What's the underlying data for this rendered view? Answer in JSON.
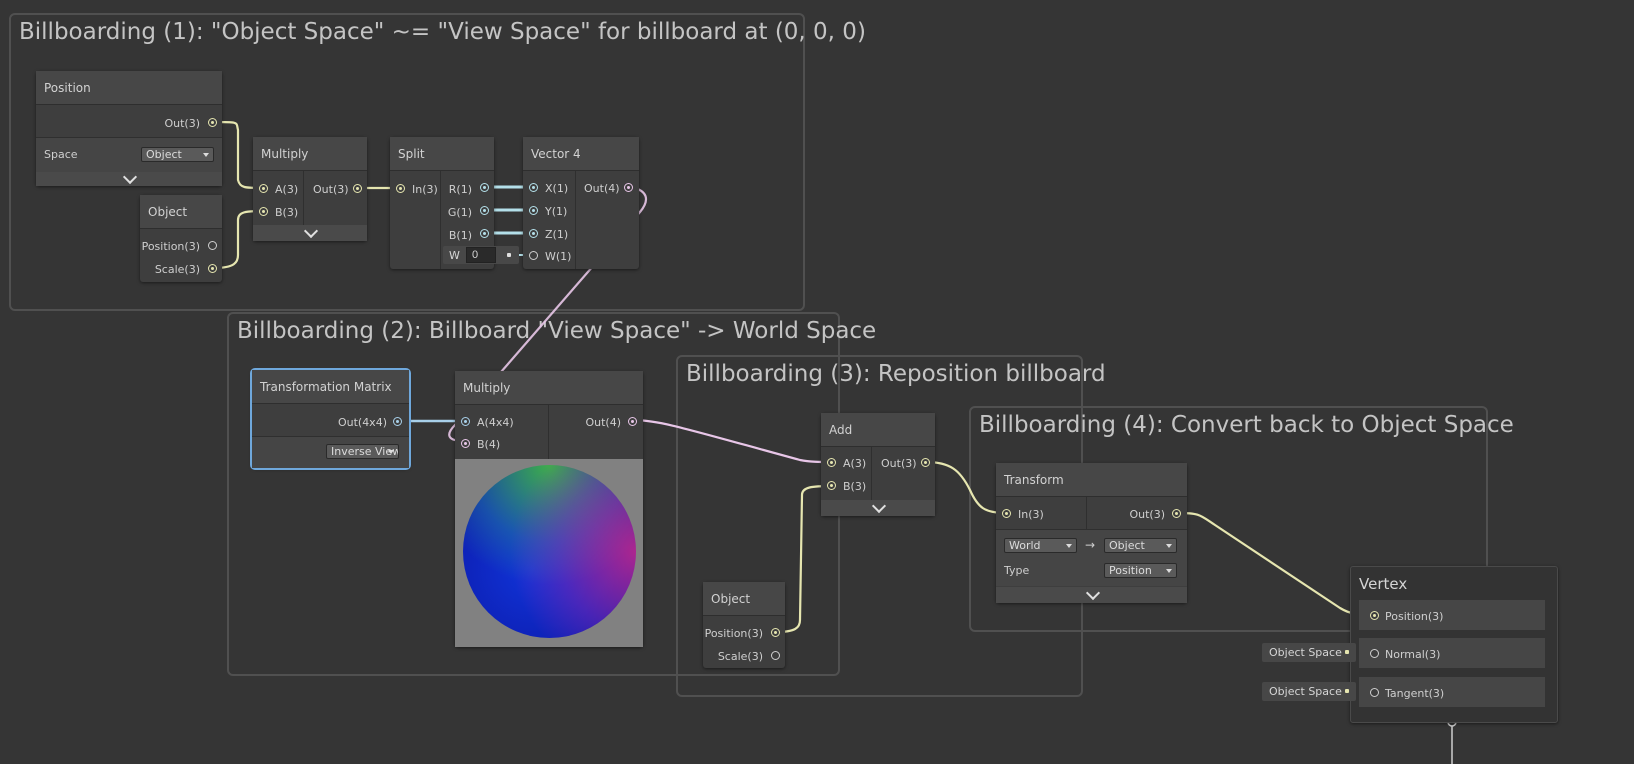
{
  "groups": {
    "g1_title": "Billboarding (1): \"Object Space\" ~= \"View Space\" for billboard at (0, 0, 0)",
    "g2_title": "Billboarding (2): Billboard \"View Space\" -> World Space",
    "g3_title": "Billboarding (3): Reposition billboard",
    "g4_title": "Billboarding (4): Convert back to Object Space"
  },
  "position_node": {
    "title": "Position",
    "out": "Out(3)",
    "space_label": "Space",
    "space_value": "Object"
  },
  "object_node_1": {
    "title": "Object",
    "position": "Position(3)",
    "scale": "Scale(3)"
  },
  "multiply_node_1": {
    "title": "Multiply",
    "a": "A(3)",
    "b": "B(3)",
    "out": "Out(3)"
  },
  "split_node": {
    "title": "Split",
    "in": "In(3)",
    "r": "R(1)",
    "g": "G(1)",
    "b": "B(1)",
    "w_label": "W",
    "w_value": "0"
  },
  "vector4_node": {
    "title": "Vector 4",
    "x": "X(1)",
    "y": "Y(1)",
    "z": "Z(1)",
    "w": "W(1)",
    "out": "Out(4)"
  },
  "transform_matrix_node": {
    "title": "Transformation Matrix",
    "out": "Out(4x4)",
    "dropdown": "Inverse View"
  },
  "multiply_node_2": {
    "title": "Multiply",
    "a": "A(4x4)",
    "b": "B(4)",
    "out": "Out(4)"
  },
  "object_node_2": {
    "title": "Object",
    "position": "Position(3)",
    "scale": "Scale(3)"
  },
  "add_node": {
    "title": "Add",
    "a": "A(3)",
    "b": "B(3)",
    "out": "Out(3)"
  },
  "transform_node": {
    "title": "Transform",
    "in": "In(3)",
    "out": "Out(3)",
    "from": "World",
    "to": "Object",
    "type_label": "Type",
    "type_value": "Position"
  },
  "vertex_node": {
    "title": "Vertex",
    "position": "Position(3)",
    "normal": "Normal(3)",
    "tangent": "Tangent(3)",
    "normal_pill": "Object Space",
    "tangent_pill": "Object Space"
  },
  "colors": {
    "background": "#353535",
    "vector3_wire": "#e6e6b0",
    "vector1_wire": "#b4e0ea",
    "vector4_wire": "#e8c6e8",
    "matrix_wire": "#a8d0ea",
    "selection": "#6fa8dc"
  }
}
